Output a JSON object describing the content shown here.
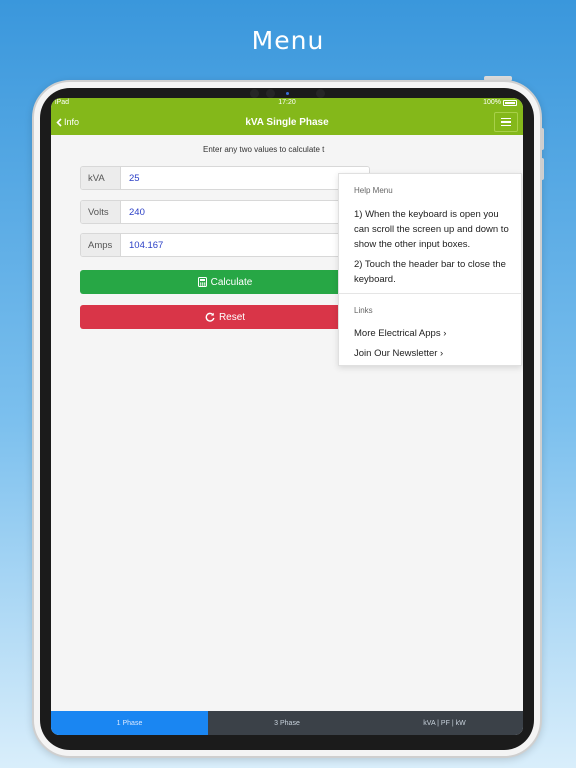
{
  "promo": {
    "title": "Menu"
  },
  "status_bar": {
    "carrier": "iPad",
    "time": "17:20",
    "battery": "100%"
  },
  "navbar": {
    "back_label": "Info",
    "title": "kVA Single Phase"
  },
  "form": {
    "instruction": "Enter any two values to calculate t",
    "fields": [
      {
        "label": "kVA",
        "value": "25"
      },
      {
        "label": "Volts",
        "value": "240"
      },
      {
        "label": "Amps",
        "value": "104.167"
      }
    ],
    "calculate_label": "Calculate",
    "reset_label": "Reset"
  },
  "help_menu": {
    "header": "Help Menu",
    "item1": "1) When the keyboard is open you can scroll the screen up and down to show the other input boxes.",
    "item2": "2) Touch the header bar to close the keyboard.",
    "links_header": "Links",
    "link1": "More Electrical Apps ›",
    "link2": "Join Our Newsletter ›"
  },
  "tabs": [
    {
      "label": "1 Phase",
      "active": true
    },
    {
      "label": "3 Phase",
      "active": false
    },
    {
      "label": "kVA | PF | kW",
      "active": false
    }
  ],
  "colors": {
    "navbar": "#84b81a",
    "calculate": "#27a745",
    "reset": "#d93548",
    "tab_active": "#1a86f2",
    "tab_inactive": "#3b4148",
    "input_value": "#2b3fc6"
  }
}
